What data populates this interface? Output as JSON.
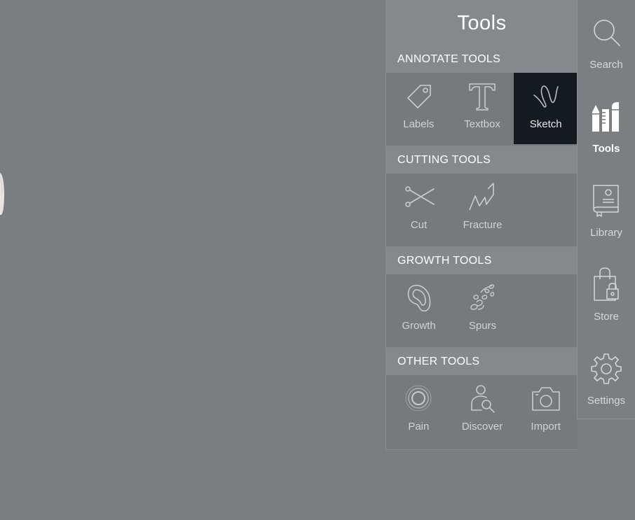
{
  "panel": {
    "title": "Tools",
    "sections": [
      {
        "title": "ANNOTATE TOOLS",
        "tools": [
          {
            "label": "Labels",
            "icon": "tag-icon"
          },
          {
            "label": "Textbox",
            "icon": "text-t-icon"
          },
          {
            "label": "Sketch",
            "icon": "squiggle-icon",
            "selected": true
          }
        ]
      },
      {
        "title": "CUTTING TOOLS",
        "tools": [
          {
            "label": "Cut",
            "icon": "scissors-icon"
          },
          {
            "label": "Fracture",
            "icon": "zigzag-icon"
          }
        ]
      },
      {
        "title": "GROWTH TOOLS",
        "tools": [
          {
            "label": "Growth",
            "icon": "growth-icon"
          },
          {
            "label": "Spurs",
            "icon": "spurs-icon"
          }
        ]
      },
      {
        "title": "OTHER TOOLS",
        "tools": [
          {
            "label": "Pain",
            "icon": "pain-rings-icon"
          },
          {
            "label": "Discover",
            "icon": "person-search-icon"
          },
          {
            "label": "Import",
            "icon": "camera-icon"
          }
        ]
      }
    ]
  },
  "nav": {
    "items": [
      {
        "label": "Search",
        "icon": "search-icon"
      },
      {
        "label": "Tools",
        "icon": "tools-icon",
        "active": true
      },
      {
        "label": "Library",
        "icon": "book-icon"
      },
      {
        "label": "Store",
        "icon": "shopping-bag-icon"
      },
      {
        "label": "Settings",
        "icon": "gear-icon"
      }
    ]
  },
  "colors": {
    "background": "#7b7e80",
    "panel": "#767a7d",
    "header": "#86898c",
    "selected": "#151a20",
    "text": "#ffffff"
  }
}
